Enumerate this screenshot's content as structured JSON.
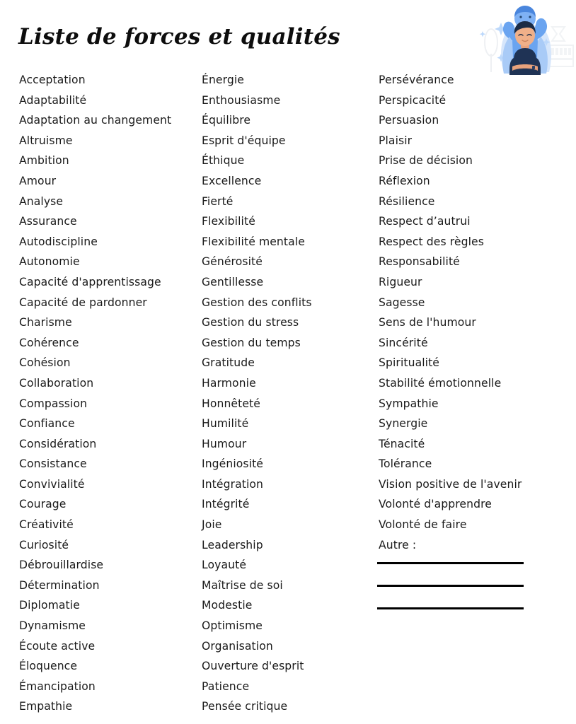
{
  "document": {
    "title": "Liste de forces et qualités",
    "background_color": "#ffffff",
    "text_color": "#1a1a1a"
  },
  "columns": [
    {
      "id": "column-1",
      "items": [
        "Acceptation",
        "Adaptabilité",
        "Adaptation au changement",
        "Altruisme",
        "Ambition",
        "Amour",
        "Analyse",
        "Assurance",
        "Autodiscipline",
        "Autonomie",
        "Capacité d'apprentissage",
        "Capacité de pardonner",
        "Charisme",
        "Cohérence",
        "Cohésion",
        "Collaboration",
        "Compassion",
        "Confiance",
        "Considération",
        "Consistance",
        "Convivialité",
        "Courage",
        "Créativité",
        "Curiosité",
        "Débrouillardise",
        "Détermination",
        "Diplomatie",
        "Dynamisme",
        "Écoute active",
        "Éloquence",
        "Émancipation",
        "Empathie"
      ]
    },
    {
      "id": "column-2",
      "items": [
        "Énergie",
        "Enthousiasme",
        "Équilibre",
        "Esprit d'équipe",
        "Éthique",
        "Excellence",
        "Fierté",
        "Flexibilité",
        "Flexibilité mentale",
        "Générosité",
        "Gentillesse",
        "Gestion des conflits",
        "Gestion du stress",
        "Gestion du temps",
        "Gratitude",
        "Harmonie",
        "Honnêteté",
        "Humilité",
        "Humour",
        "Ingéniosité",
        "Intégration",
        "Intégrité",
        "Joie",
        "Leadership",
        "Loyauté",
        "Maîtrise de soi",
        "Modestie",
        "Optimisme",
        "Organisation",
        "Ouverture d'esprit",
        "Patience",
        "Pensée critique"
      ]
    },
    {
      "id": "column-3",
      "items": [
        "Persévérance",
        "Perspicacité",
        "Persuasion",
        "Plaisir",
        "Prise de décision",
        "Réflexion",
        "Résilience",
        "Respect d’autrui",
        "Respect des règles",
        "Responsabilité",
        "Rigueur",
        "Sagesse",
        "Sens de l'humour",
        "Sincérité",
        "Spiritualité",
        "Stabilité émotionnelle",
        "Sympathie",
        "Synergie",
        "Ténacité",
        "Tolérance",
        "Vision positive de l'avenir",
        "Volonté d'apprendre",
        "Volonté de faire",
        "Autre :"
      ]
    }
  ],
  "write_in_lines": {
    "count": 3,
    "color": "#000000"
  },
  "illustration": {
    "name": "person-with-superhero-shadow-illustration",
    "description": "Personne aux bras croisés devant une silhouette bleue de super-héros",
    "colors": {
      "hero_blue": "#6aa4f0",
      "hero_blue_dark": "#4a86dd",
      "cape_blue_light": "#a9cbf7",
      "shirt_navy": "#1f3355",
      "skin": "#f0b089",
      "hair_dark": "#1b2b45",
      "background_gray": "#e9ecef",
      "sparkle_blue": "#bcd8fb"
    }
  }
}
